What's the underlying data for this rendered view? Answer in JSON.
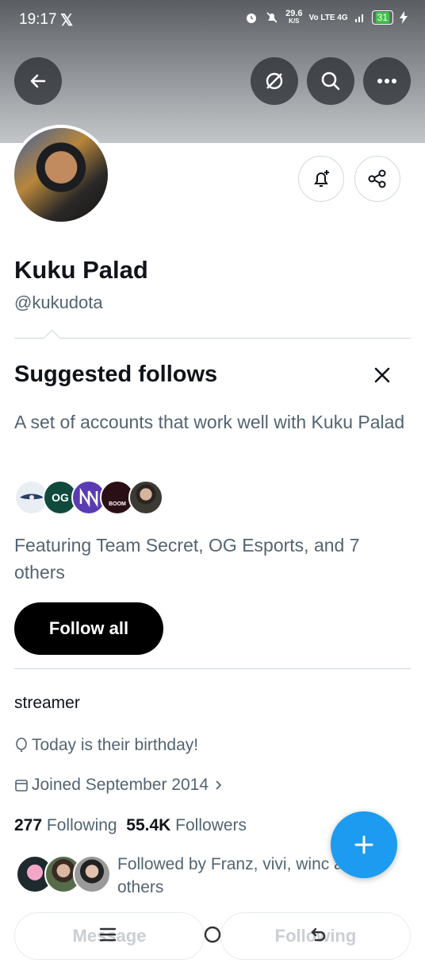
{
  "status_bar": {
    "time": "19:17",
    "x_logo": "𝕏",
    "net_speed": "29.6",
    "net_unit": "K/S",
    "network": "Vo LTE 4G",
    "battery": "31"
  },
  "header": {
    "back_icon": "arrow-left-icon",
    "repost_off_icon": "reposts-off-icon",
    "search_icon": "search-icon",
    "more_icon": "more-icon"
  },
  "profile": {
    "name": "Kuku Palad",
    "handle": "@kukudota"
  },
  "suggested": {
    "title": "Suggested follows",
    "description": "A set of accounts that work well with Kuku Palad",
    "featuring": "Featuring Team Secret, OG Esports, and 7 others",
    "follow_all": "Follow all",
    "face_colors": [
      "#e9eef4",
      "#0f4a3c",
      "#5b3bb4",
      "#2a1016",
      "#3d3a36"
    ],
    "face_labels": [
      "",
      "OG",
      "",
      "BOOM",
      ""
    ]
  },
  "bio": "streamer",
  "birthday": "Today is their birthday!",
  "joined": "Joined September 2014",
  "following_count": "277",
  "following_label": "Following",
  "followers_count": "55.4K",
  "followers_label": "Followers",
  "followed_by": "Followed by Franz, vivi, winc and 27 others",
  "buttons": {
    "message": "Message",
    "following": "Following"
  },
  "colors": {
    "accent": "#1d9bf0",
    "text": "#0f1419",
    "secondary": "#536471"
  }
}
